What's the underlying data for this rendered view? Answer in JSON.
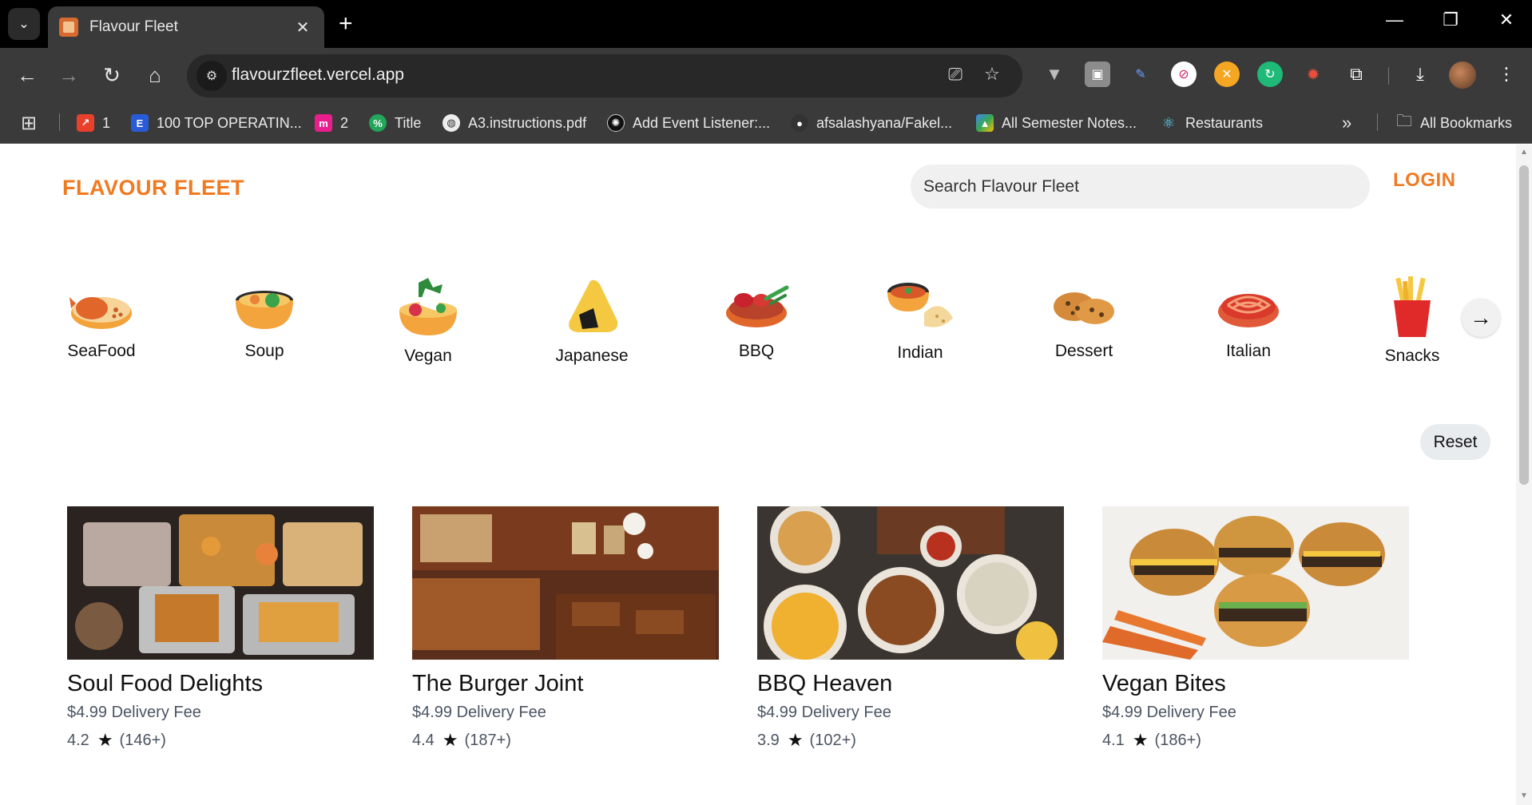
{
  "browser": {
    "tab_title": "Flavour Fleet",
    "url": "flavourzfleet.vercel.app",
    "bookmarks": [
      {
        "label": "1",
        "color": "#e8402a"
      },
      {
        "label": "100 TOP OPERATIN...",
        "color": "#2a5bd7"
      },
      {
        "label": "2",
        "color": "#e91e8c"
      },
      {
        "label": "Title",
        "color": "#23a55a"
      },
      {
        "label": "A3.instructions.pdf",
        "color": "#eeeeee"
      },
      {
        "label": "Add Event Listener:...",
        "color": "#111111"
      },
      {
        "label": "afsalashyana/Fakel...",
        "color": "#333333"
      },
      {
        "label": "All Semester Notes...",
        "color": "#f2b705"
      },
      {
        "label": "Restaurants",
        "color": "#61dafb"
      }
    ],
    "all_bookmarks": "All Bookmarks"
  },
  "header": {
    "brand": "FLAVOUR FLEET",
    "search_placeholder": "Search Flavour Fleet",
    "login": "LOGIN"
  },
  "categories": [
    {
      "label": "SeaFood",
      "icon": "seafood-icon"
    },
    {
      "label": "Soup",
      "icon": "soup-icon"
    },
    {
      "label": "Vegan",
      "icon": "vegan-icon"
    },
    {
      "label": "Japanese",
      "icon": "onigiri-icon"
    },
    {
      "label": "BBQ",
      "icon": "bbq-icon"
    },
    {
      "label": "Indian",
      "icon": "curry-icon"
    },
    {
      "label": "Dessert",
      "icon": "cookie-icon"
    },
    {
      "label": "Italian",
      "icon": "pasta-icon"
    },
    {
      "label": "Snacks",
      "icon": "fries-icon"
    }
  ],
  "reset_label": "Reset",
  "restaurants": [
    {
      "name": "Soul Food Delights",
      "fee": "$4.99 Delivery Fee",
      "rating": "4.2",
      "reviews": "(146+)"
    },
    {
      "name": "The Burger Joint",
      "fee": "$4.99 Delivery Fee",
      "rating": "4.4",
      "reviews": "(187+)"
    },
    {
      "name": "BBQ Heaven",
      "fee": "$4.99 Delivery Fee",
      "rating": "3.9",
      "reviews": "(102+)"
    },
    {
      "name": "Vegan Bites",
      "fee": "$4.99 Delivery Fee",
      "rating": "4.1",
      "reviews": "(186+)"
    }
  ],
  "colors": {
    "brand": "#f07a22",
    "chrome_dark": "#3a3a3a",
    "muted_text": "#4b5563"
  }
}
